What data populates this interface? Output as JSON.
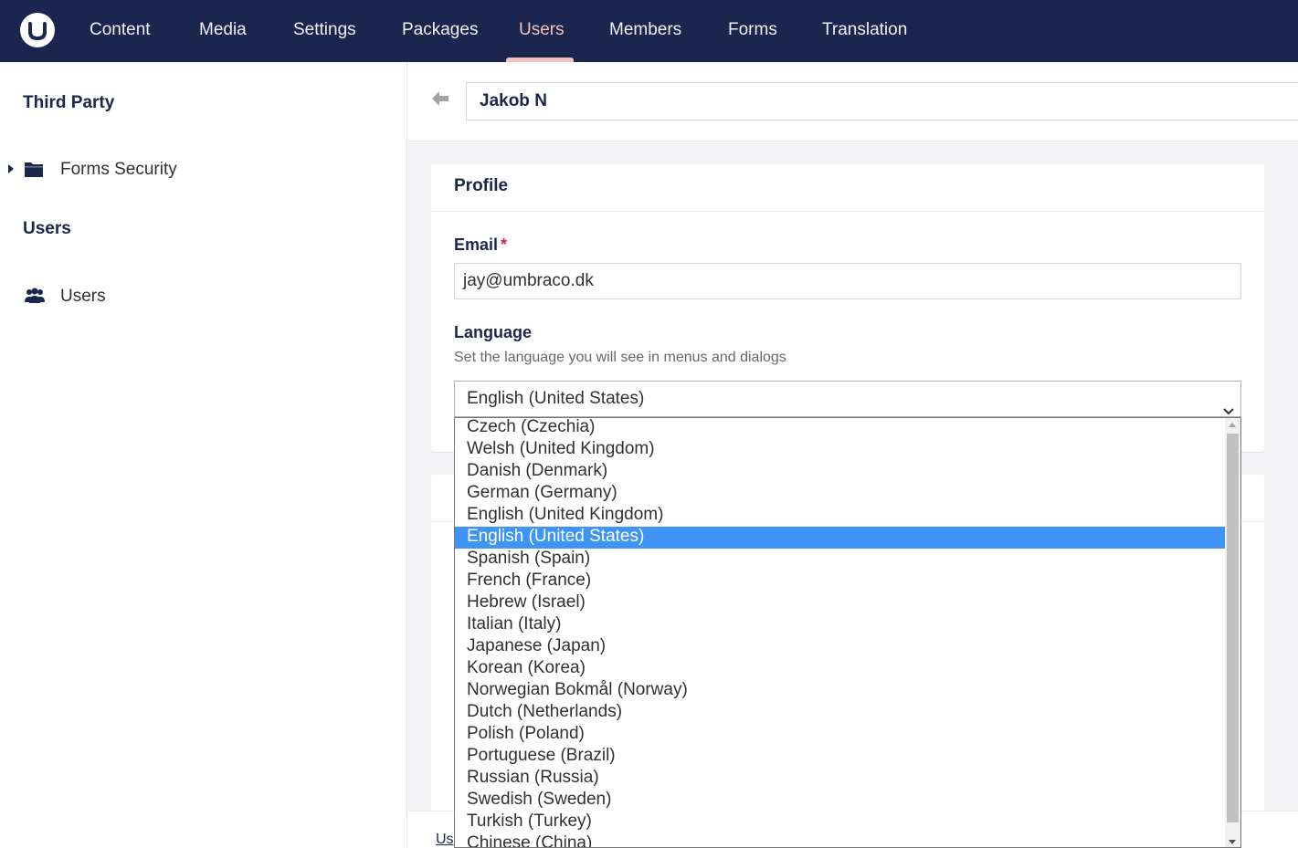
{
  "topnav": {
    "items": [
      {
        "label": "Content",
        "active": false
      },
      {
        "label": "Media",
        "active": false
      },
      {
        "label": "Settings",
        "active": false
      },
      {
        "label": "Packages",
        "active": false
      },
      {
        "label": "Users",
        "active": true
      },
      {
        "label": "Members",
        "active": false
      },
      {
        "label": "Forms",
        "active": false
      },
      {
        "label": "Translation",
        "active": false
      }
    ],
    "background": "#1b264f",
    "active_color": "#f5c1bc"
  },
  "sidebar": {
    "section_third_party": "Third Party",
    "forms_security": "Forms Security",
    "section_users": "Users",
    "users_item": "Users"
  },
  "editor": {
    "user_name": "Jakob N"
  },
  "profile": {
    "title": "Profile",
    "email_label": "Email",
    "email_required_mark": "*",
    "email_value": "jay@umbraco.dk",
    "language_label": "Language",
    "language_description": "Set the language you will see in menus and dialogs",
    "language_selected": "English (United States)"
  },
  "language_options": [
    "Czech (Czechia)",
    "Welsh (United Kingdom)",
    "Danish (Denmark)",
    "German (Germany)",
    "English (United Kingdom)",
    "English (United States)",
    "Spanish (Spain)",
    "French (France)",
    "Hebrew (Israel)",
    "Italian (Italy)",
    "Japanese (Japan)",
    "Korean (Korea)",
    "Norwegian Bokmål (Norway)",
    "Dutch (Netherlands)",
    "Polish (Poland)",
    "Portuguese (Brazil)",
    "Russian (Russia)",
    "Swedish (Sweden)",
    "Turkish (Turkey)",
    "Chinese (China)"
  ],
  "selected_option_index": 5,
  "footer": {
    "text": "Us"
  },
  "colors": {
    "selected_option": "#3e95f5",
    "brand_dark": "#1b264f"
  }
}
